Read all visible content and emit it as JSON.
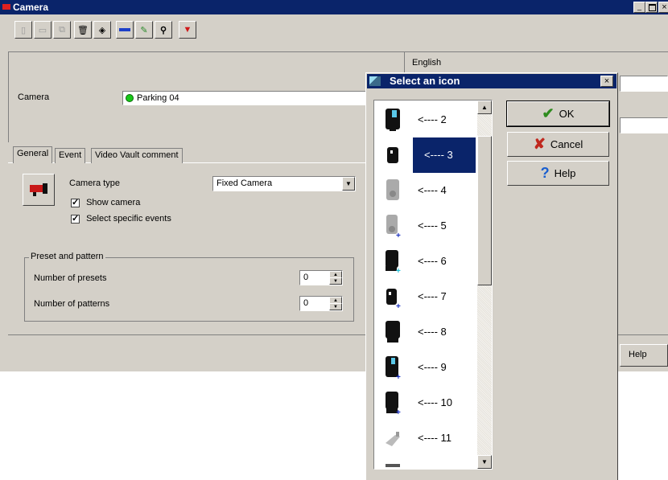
{
  "window": {
    "title": "Camera"
  },
  "toolbar": {
    "buttons": [
      "new-icon",
      "save-icon",
      "copy-icon",
      "delete-icon",
      "print-icon",
      "link-icon",
      "tool-icon",
      "search-icon",
      "camera-icon"
    ]
  },
  "header": {
    "camera_label": "Camera",
    "camera_value": "Parking 04",
    "language": "English"
  },
  "tabs": [
    "General",
    "Event",
    "Video Vault comment"
  ],
  "general": {
    "camera_type_label": "Camera type",
    "camera_type_value": "Fixed Camera",
    "show_camera": "Show camera",
    "select_events": "Select specific events"
  },
  "preset": {
    "legend": "Preset and pattern",
    "presets_label": "Number of presets",
    "presets_value": "0",
    "patterns_label": "Number of patterns",
    "patterns_value": "0"
  },
  "bottom": {
    "help_label": "Help"
  },
  "dialog": {
    "title": "Select an icon",
    "close": "×",
    "ok": "OK",
    "cancel": "Cancel",
    "help": "Help",
    "icons": [
      {
        "label": "<---- 2"
      },
      {
        "label": "<---- 3"
      },
      {
        "label": "<---- 4"
      },
      {
        "label": "<---- 5"
      },
      {
        "label": "<---- 6"
      },
      {
        "label": "<---- 7"
      },
      {
        "label": "<---- 8"
      },
      {
        "label": "<---- 9"
      },
      {
        "label": "<---- 10"
      },
      {
        "label": "<---- 11"
      }
    ],
    "selected_index": 1
  },
  "colors": {
    "titlebar": "#0a246a",
    "selection": "#0a246a",
    "face": "#d4d0c8",
    "ok_green": "#2e8b1e",
    "cancel_red": "#c0281e",
    "help_blue": "#1a5fd0"
  }
}
